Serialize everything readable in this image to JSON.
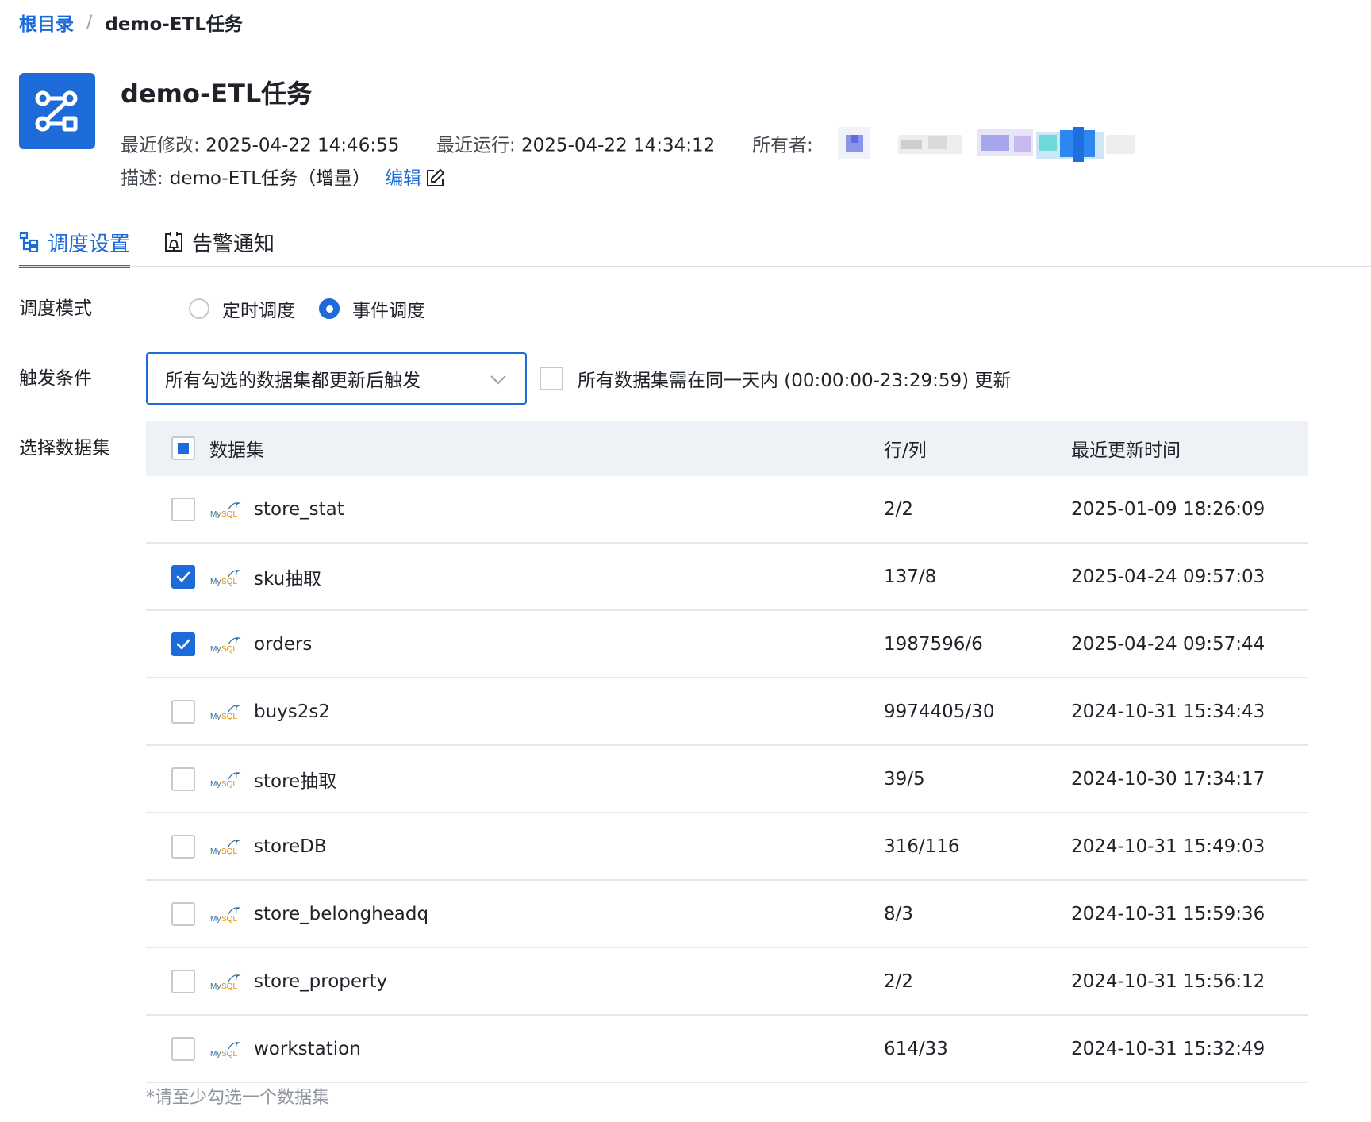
{
  "breadcrumb": {
    "root": "根目录",
    "separator": "/",
    "current": "demo-ETL任务"
  },
  "header": {
    "icon": "etl-task-icon",
    "title": "demo-ETL任务",
    "last_modified_label": "最近修改:",
    "last_modified_value": "2025-04-22 14:46:55",
    "last_run_label": "最近运行:",
    "last_run_value": "2025-04-22 14:34:12",
    "owner_label": "所有者:",
    "description_label": "描述:",
    "description_value": "demo-ETL任务（增量）",
    "edit_label": "编辑"
  },
  "tabs": [
    {
      "label": "调度设置",
      "icon": "schedule-tree-icon",
      "active": true
    },
    {
      "label": "告警通知",
      "icon": "alarm-bell-icon",
      "active": false
    }
  ],
  "schedule": {
    "mode_label": "调度模式",
    "mode_options": [
      {
        "label": "定时调度",
        "checked": false
      },
      {
        "label": "事件调度",
        "checked": true
      }
    ],
    "trigger_label": "触发条件",
    "trigger_value": "所有勾选的数据集都更新后触发",
    "same_day_label": "所有数据集需在同一天内 (00:00:00-23:29:59) 更新",
    "same_day_checked": false,
    "dataset_label": "选择数据集"
  },
  "table": {
    "columns": [
      "数据集",
      "行/列",
      "最近更新时间"
    ],
    "header_check_state": "partial",
    "source_icon": "mysql-icon",
    "rows": [
      {
        "name": "store_stat",
        "rows_cols": "2/2",
        "updated": "2025-01-09 18:26:09",
        "checked": false
      },
      {
        "name": "sku抽取",
        "rows_cols": "137/8",
        "updated": "2025-04-24 09:57:03",
        "checked": true
      },
      {
        "name": "orders",
        "rows_cols": "1987596/6",
        "updated": "2025-04-24 09:57:44",
        "checked": true
      },
      {
        "name": "buys2s2",
        "rows_cols": "9974405/30",
        "updated": "2024-10-31 15:34:43",
        "checked": false
      },
      {
        "name": "store抽取",
        "rows_cols": "39/5",
        "updated": "2024-10-30 17:34:17",
        "checked": false
      },
      {
        "name": "storeDB",
        "rows_cols": "316/116",
        "updated": "2024-10-31 15:49:03",
        "checked": false
      },
      {
        "name": "store_belongheadq",
        "rows_cols": "8/3",
        "updated": "2024-10-31 15:59:36",
        "checked": false
      },
      {
        "name": "store_property",
        "rows_cols": "2/2",
        "updated": "2024-10-31 15:56:12",
        "checked": false
      },
      {
        "name": "workstation",
        "rows_cols": "614/33",
        "updated": "2024-10-31 15:32:49",
        "checked": false
      }
    ]
  },
  "hint": "*请至少勾选一个数据集",
  "colors": {
    "accent": "#1c6bd8",
    "header_bg": "#eef1f5",
    "divider": "#e4e7eb"
  }
}
